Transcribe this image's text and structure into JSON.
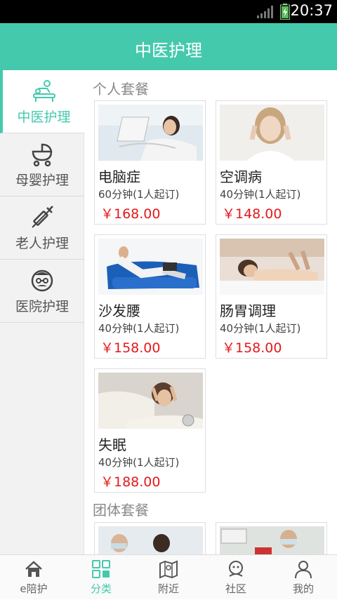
{
  "status": {
    "time": "20:37"
  },
  "header": {
    "title": "中医护理"
  },
  "colors": {
    "accent": "#45c9ad",
    "price": "#e4191b"
  },
  "sidebar": {
    "items": [
      {
        "label": "中医护理",
        "icon": "massage-icon",
        "active": true
      },
      {
        "label": "母婴护理",
        "icon": "baby-stroller-icon",
        "active": false
      },
      {
        "label": "老人护理",
        "icon": "syringe-icon",
        "active": false
      },
      {
        "label": "医院护理",
        "icon": "doctor-icon",
        "active": false
      }
    ]
  },
  "sections": {
    "personal": "个人套餐",
    "group": "团体套餐"
  },
  "packages": [
    {
      "name": "电脑症",
      "duration": "60分钟(1人起订)",
      "price": "￥168.00"
    },
    {
      "name": "空调病",
      "duration": "40分钟(1人起订)",
      "price": "￥148.00"
    },
    {
      "name": "沙发腰",
      "duration": "40分钟(1人起订)",
      "price": "￥158.00"
    },
    {
      "name": "肠胃调理",
      "duration": "40分钟(1人起订)",
      "price": "￥158.00"
    },
    {
      "name": "失眠",
      "duration": "40分钟(1人起订)",
      "price": "￥188.00"
    }
  ],
  "tabs": [
    {
      "label": "e陪护",
      "icon": "home-icon",
      "active": false
    },
    {
      "label": "分类",
      "icon": "grid-icon",
      "active": true
    },
    {
      "label": "附近",
      "icon": "map-icon",
      "active": false
    },
    {
      "label": "社区",
      "icon": "community-icon",
      "active": false
    },
    {
      "label": "我的",
      "icon": "user-icon",
      "active": false
    }
  ]
}
